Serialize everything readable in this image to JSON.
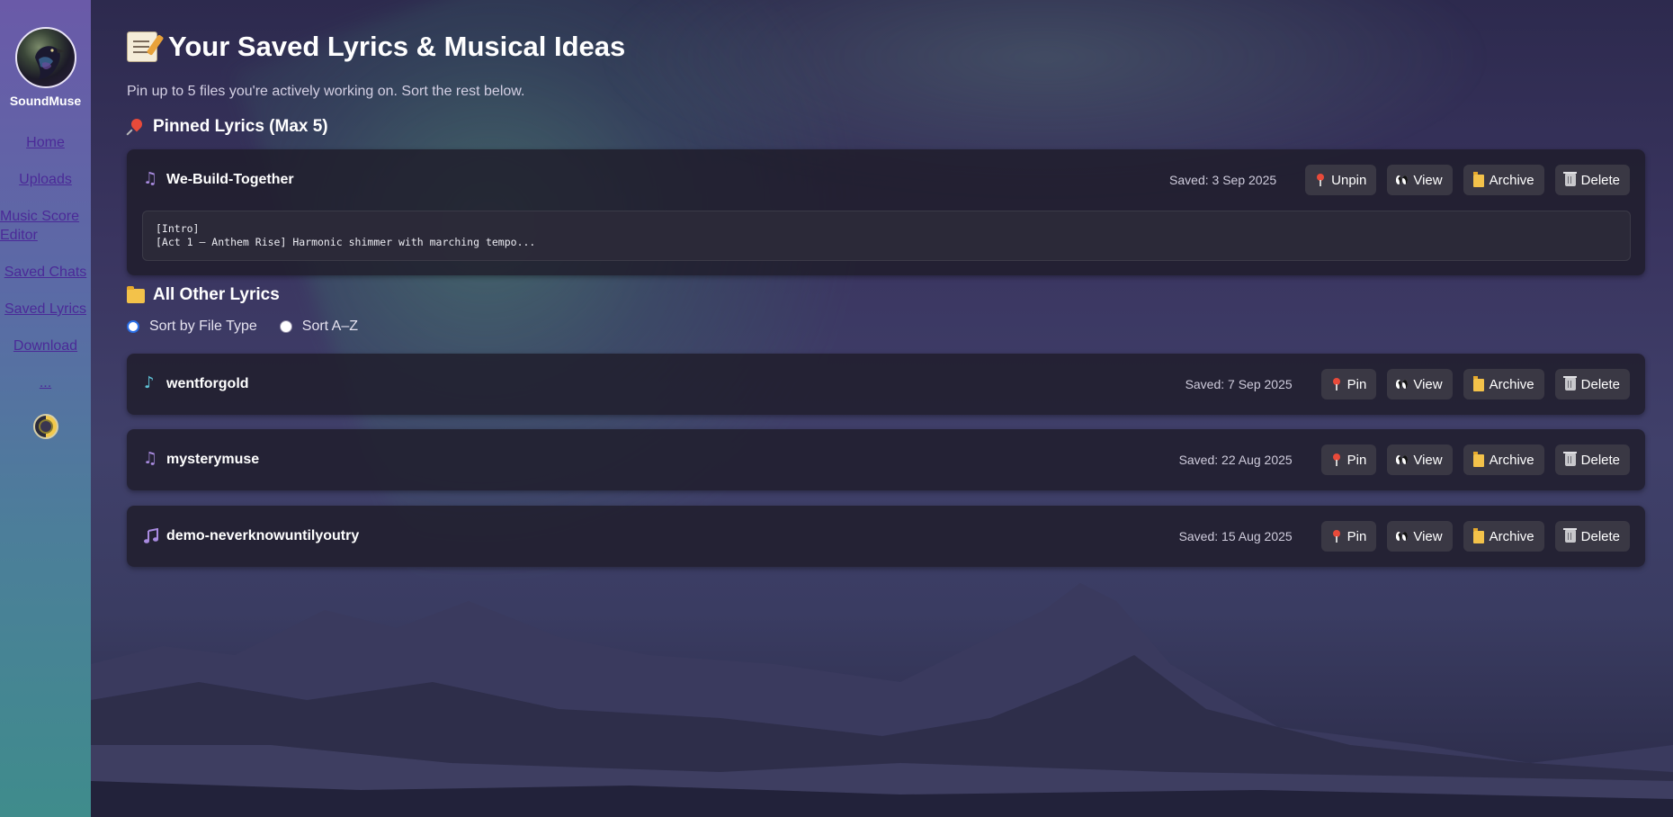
{
  "app": {
    "brand": "SoundMuse"
  },
  "sidebar": {
    "items": [
      {
        "label": "Home"
      },
      {
        "label": "Uploads"
      },
      {
        "label": "Music Score Editor"
      },
      {
        "label": "Saved Chats"
      },
      {
        "label": "Saved Lyrics"
      },
      {
        "label": "Download"
      },
      {
        "label": "..."
      }
    ],
    "theme_toggle_icon": "half-moon-icon"
  },
  "header": {
    "title": "Your Saved Lyrics & Musical Ideas",
    "title_icon": "memo-icon",
    "subtitle": "Pin up to 5 files you're actively working on. Sort the rest below."
  },
  "pinned": {
    "title": "Pinned Lyrics (Max 5)",
    "icon": "pushpin-icon",
    "items": [
      {
        "name": "We-Build-Together",
        "icon": "music-notes-icon",
        "saved": "Saved: 3 Sep 2025",
        "pin_label": "Unpin",
        "view_label": "View",
        "archive_label": "Archive",
        "delete_label": "Delete",
        "preview_line_1": "[Intro]",
        "preview_line_2": "[Act 1 – Anthem Rise] Harmonic shimmer with marching tempo..."
      }
    ]
  },
  "others": {
    "title": "All Other Lyrics",
    "icon": "folder-icon",
    "sort_options": [
      {
        "label": "Sort by File Type",
        "selected": true
      },
      {
        "label": "Sort A–Z",
        "selected": false
      }
    ],
    "items": [
      {
        "name": "wentforgold",
        "icon": "treble-clef-icon",
        "saved": "Saved: 7 Sep 2025",
        "pin_label": "Pin",
        "view_label": "View",
        "archive_label": "Archive",
        "delete_label": "Delete"
      },
      {
        "name": "mysterymuse",
        "icon": "music-notes-icon",
        "saved": "Saved: 22 Aug 2025",
        "pin_label": "Pin",
        "view_label": "View",
        "archive_label": "Archive",
        "delete_label": "Delete"
      },
      {
        "name": "demo-neverknowuntilyoutry",
        "icon": "music-note-icon",
        "saved": "Saved: 15 Aug 2025",
        "pin_label": "Pin",
        "view_label": "View",
        "archive_label": "Archive",
        "delete_label": "Delete"
      }
    ]
  },
  "colors": {
    "sidebar_top": "#6a5aa8",
    "sidebar_bottom": "#3f8c8c",
    "card_bg": "#1e1c2a",
    "button_bg": "#3a3844",
    "link": "#4b2a98",
    "radio_accent": "#2a6ee6"
  }
}
